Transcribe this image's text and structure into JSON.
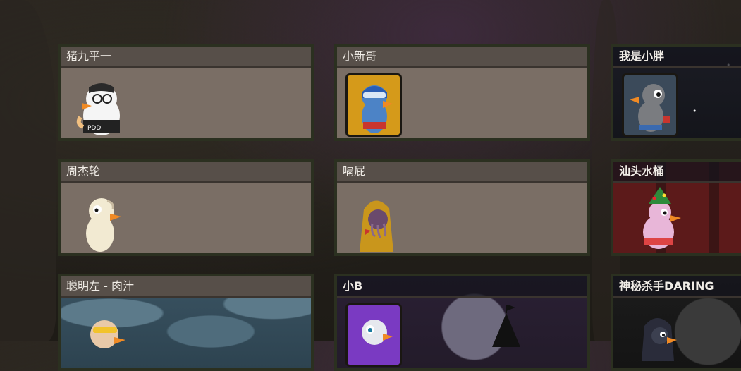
{
  "players": [
    {
      "name": "猪九平一",
      "character": "penguin-goose-glasses-pdd"
    },
    {
      "name": "小新哥",
      "character": "goose-blue-helmet"
    },
    {
      "name": "我是小胖",
      "character": "goose-gray-space"
    },
    {
      "name": "周杰轮",
      "character": "goose-white-plain"
    },
    {
      "name": "嗝屁",
      "character": "goose-yellow-hood-tentacles"
    },
    {
      "name": "汕头水桶",
      "character": "goose-pink-christmas-tree-hat"
    },
    {
      "name": "聪明左 - 肉汁",
      "character": "goose-sunglasses-fish-bg"
    },
    {
      "name": "小B",
      "character": "goose-purple-frame-night-bg"
    },
    {
      "name": "神秘杀手DARING",
      "character": "goose-dark-hood-gear-bg"
    }
  ],
  "colors": {
    "card_body": "#7a6e65",
    "card_header": "#574f49",
    "card_border": "#2b3020",
    "name_text": "#f0ece6"
  }
}
